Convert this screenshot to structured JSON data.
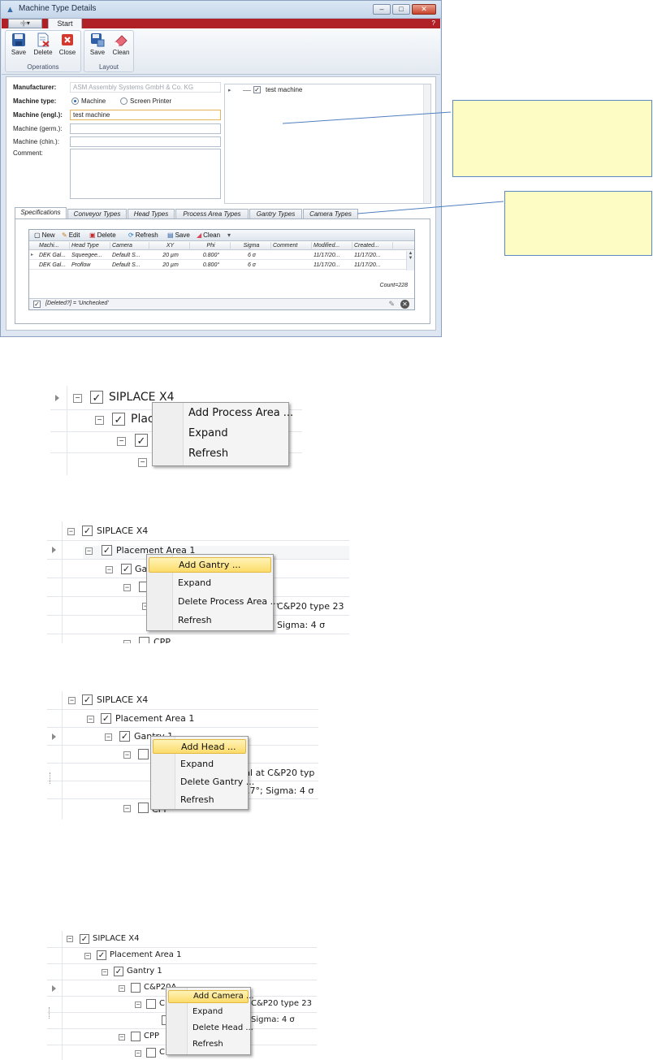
{
  "window": {
    "title": "Machine Type Details",
    "quick_access": "▫|▫▾",
    "tab_start": "Start",
    "help": "?"
  },
  "ribbon": {
    "operations": {
      "label": "Operations",
      "save": "Save",
      "delete": "Delete",
      "close": "Close"
    },
    "layout": {
      "label": "Layout",
      "save": "Save",
      "clean": "Clean"
    }
  },
  "form": {
    "manufacturer_label": "Manufacturer:",
    "manufacturer_value": "ASM Assembly Systems GmbH & Co. KG",
    "machine_type_label": "Machine type:",
    "machine_type_options": [
      "Machine",
      "Screen Printer"
    ],
    "machine_engl_label": "Machine (engl.):",
    "machine_engl_value": "test machine",
    "machine_germ_label": "Machine (germ.):",
    "machine_chin_label": "Machine (chin.):",
    "comment_label": "Comment:"
  },
  "tree_root": "test machine",
  "tabs": [
    "Specifications",
    "Conveyor Types",
    "Head Types",
    "Process Area Types",
    "Gantry Types",
    "Camera Types"
  ],
  "grid": {
    "toolbar": {
      "new": "New",
      "edit": "Edit",
      "delete": "Delete",
      "refresh": "Refresh",
      "save": "Save",
      "clean": "Clean"
    },
    "columns": [
      "Machi...",
      "Head Type",
      "Camera",
      "XY",
      "Phi",
      "Sigma",
      "Comment",
      "Modified...",
      "Created..."
    ],
    "rows": [
      [
        "DEK Gal...",
        "Squeegee...",
        "Default S...",
        "20 µm",
        "0.800°",
        "6 σ",
        "",
        "11/17/20...",
        "11/17/20..."
      ],
      [
        "DEK Gal...",
        "Proflow",
        "Default S...",
        "20 µm",
        "0.800°",
        "6 σ",
        "",
        "11/17/20...",
        "11/17/20..."
      ]
    ],
    "count": "Count=228",
    "filter": "[Deleted?] = 'Unchecked'"
  },
  "menu1": {
    "tree": [
      "SIPLACE X4",
      "Place"
    ],
    "items": [
      "Add Process Area ...",
      "Expand",
      "Refresh"
    ]
  },
  "menu2": {
    "tree": [
      "SIPLACE X4",
      "Placement Area 1",
      "Ga"
    ],
    "side_texts": [
      "C&P20 type 23",
      "Sigma: 4 σ",
      "CPP"
    ],
    "items": [
      "Add Gantry ...",
      "Expand",
      "Delete Process Area ...",
      "Refresh"
    ]
  },
  "menu3": {
    "tree": [
      "SIPLACE X4",
      "Placement Area 1",
      "Gantry 1"
    ],
    "side_texts": [
      "tal at C&P20 typ",
      "0.7°; Sigma: 4 σ",
      "CPP"
    ],
    "items": [
      "Add Head ...",
      "Expand",
      "Delete Gantry ...",
      "Refresh"
    ]
  },
  "menu4": {
    "tree": [
      "SIPLACE X4",
      "Placement Area 1",
      "Gantry 1",
      "C&P20A",
      "C",
      "CPP",
      "C"
    ],
    "side_texts": [
      "C&P20 type 23",
      "Sigma: 4 σ"
    ],
    "items": [
      "Add Camera ...",
      "Expand",
      "Delete Head ...",
      "Refresh"
    ]
  },
  "colors": {
    "ribbon_red": "#b02027",
    "callout_fill": "#fdfcc4",
    "menu_highlight": "#fbdb6a"
  }
}
